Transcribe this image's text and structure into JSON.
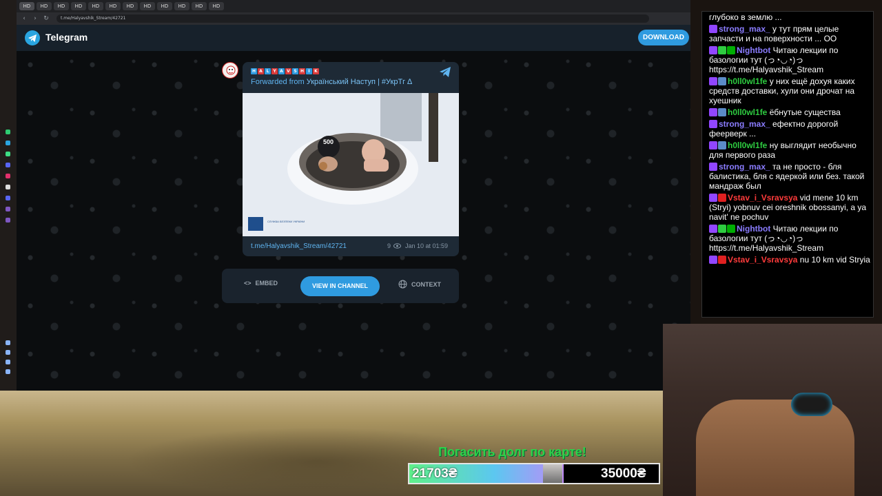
{
  "browser": {
    "url": "t.me/Halyavshik_Stream/42721",
    "tabs": [
      "HD",
      "HD",
      "HD",
      "HD",
      "HD",
      "HD",
      "HD",
      "HD",
      "HD",
      "HD",
      "HD",
      "HD"
    ]
  },
  "telegram": {
    "app_title": "Telegram",
    "download_label": "DOWNLOAD",
    "channel_letters": [
      "H",
      "A",
      "L",
      "Y",
      "A",
      "V",
      "S",
      "H",
      "I",
      "K"
    ],
    "forward_prefix": "Forwarded from",
    "forward_source": "Український Наступ | #УкрТг ∆",
    "photo_text": "500",
    "photo_caption": "СЛУЖБА БЕЗПЕКИ УКРАЇНИ",
    "post_link": "t.me/Halyavshik_Stream/42721",
    "views": "9",
    "date": "Jan 10 at 01:59",
    "embed_label": "EMBED",
    "view_in_channel_label": "VIEW IN CHANNEL",
    "context_label": "CONTEXT"
  },
  "chat": {
    "messages": [
      {
        "user": "",
        "color": "#ffffff",
        "badges": [],
        "text": "глубоко в землю ..."
      },
      {
        "user": "strong_max_",
        "color": "#8a7cff",
        "badges": [
          "#9146ff"
        ],
        "text": "у тут прям целые запчасти и на поверхности ... ОО"
      },
      {
        "user": "Nightbot",
        "color": "#8a7cff",
        "badges": [
          "#9146ff",
          "#2ecc40",
          "#00ad03"
        ],
        "text": "Читаю лекции по базологии тут (っ◔◡◔)っ https://t.me/Halyavshik_Stream"
      },
      {
        "user": "h0ll0wl1fe",
        "color": "#2ecc40",
        "badges": [
          "#9146ff",
          "#5b8cc8"
        ],
        "text": "у них ещё дохуя каких средств доставки, хули они дрочат на хуешник"
      },
      {
        "user": "h0ll0wl1fe",
        "color": "#2ecc40",
        "badges": [
          "#9146ff",
          "#5b8cc8"
        ],
        "text": "ёбнутые существа"
      },
      {
        "user": "strong_max_",
        "color": "#8a7cff",
        "badges": [
          "#9146ff"
        ],
        "text": "ефектно дорогой феерверк ..."
      },
      {
        "user": "h0ll0wl1fe",
        "color": "#2ecc40",
        "badges": [
          "#9146ff",
          "#5b8cc8"
        ],
        "text": "ну выглядит необычно для первого раза"
      },
      {
        "user": "strong_max_",
        "color": "#8a7cff",
        "badges": [
          "#9146ff"
        ],
        "text": "та не просто - бля балистика, бля с ядеркой или без. такой мандраж был"
      },
      {
        "user": "Vstav_i_Vsravsya",
        "color": "#ff3b3b",
        "badges": [
          "#9146ff",
          "#e02020"
        ],
        "text": "vid mene 10 km (Stryi) yobnuv cei oreshnik obossanyi, a ya navit' ne pochuv"
      },
      {
        "user": "Nightbot",
        "color": "#8a7cff",
        "badges": [
          "#9146ff",
          "#2ecc40",
          "#00ad03"
        ],
        "text": "Читаю лекции по базологии тут (っ◔◡◔)っ https://t.me/Halyavshik_Stream"
      },
      {
        "user": "Vstav_i_Vsravsya",
        "color": "#ff3b3b",
        "badges": [
          "#9146ff",
          "#e02020"
        ],
        "text": "nu 10 km vid Stryia"
      }
    ]
  },
  "donation": {
    "title": "Погасить долг по карте!",
    "current": "21703₴",
    "goal": "35000₴",
    "progress": 0.62
  }
}
